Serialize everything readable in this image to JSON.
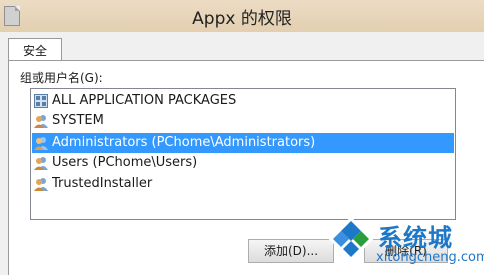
{
  "window": {
    "title": "Appx 的权限"
  },
  "tabs": [
    {
      "label": "安全"
    }
  ],
  "group": {
    "label": "组或用户名(G):"
  },
  "list": {
    "items": [
      {
        "label": "ALL APPLICATION PACKAGES",
        "icon": "app-packages-icon"
      },
      {
        "label": "SYSTEM",
        "icon": "user-group-icon"
      },
      {
        "label": "Administrators (PChome\\Administrators)",
        "icon": "user-group-icon",
        "selected": true
      },
      {
        "label": "Users (PChome\\Users)",
        "icon": "user-group-icon"
      },
      {
        "label": "TrustedInstaller",
        "icon": "user-group-icon"
      }
    ]
  },
  "buttons": {
    "add": "添加(D)...",
    "remove": "删除(R)"
  },
  "watermark": {
    "brand": "系统城",
    "url": "xitongcheng.com"
  },
  "colors": {
    "selection": "#3399ff",
    "titlebar": "#e6d4b8",
    "brand": "#1e78c8"
  }
}
